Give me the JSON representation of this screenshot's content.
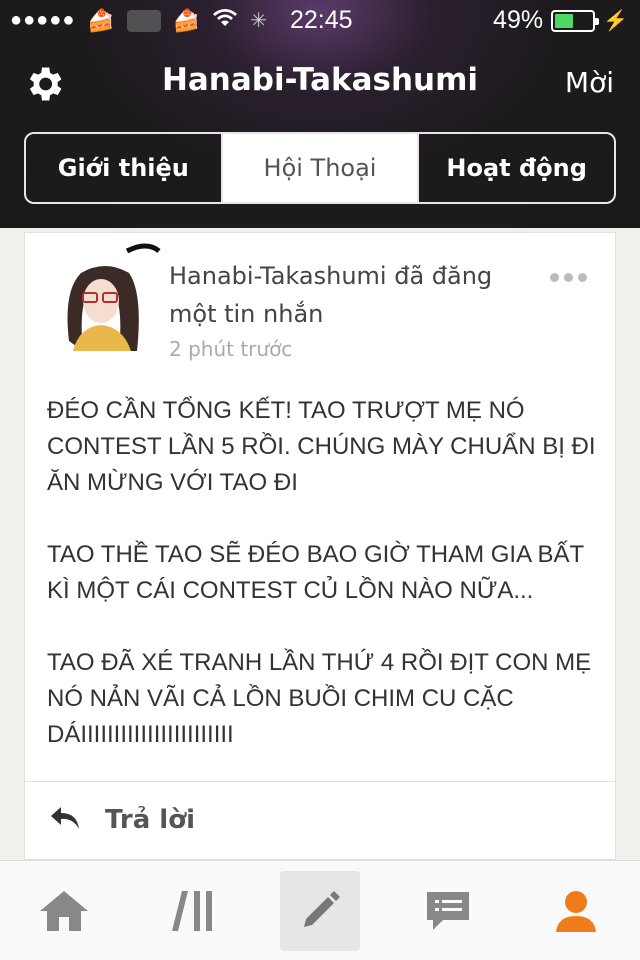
{
  "status_bar": {
    "time": "22:45",
    "battery": "49%",
    "battery_level": 0.49
  },
  "nav": {
    "title": "Hanabi-Takashumi",
    "invite": "Mời"
  },
  "tabs": [
    {
      "label": "Giới thiệu",
      "active": false
    },
    {
      "label": "Hội Thoại",
      "active": true
    },
    {
      "label": "Hoạt động",
      "active": false
    }
  ],
  "post": {
    "author_line": "Hanabi-Takashumi đã đăng một tin nhắn",
    "time_ago": "2 phút trước",
    "paragraphs": [
      "ĐÉO CẦN TỔNG KẾT! TAO TRƯỢT MẸ NÓ CONTEST LẦN 5 RỒI. CHÚNG MÀY CHUẨN BỊ ĐI ĂN MỪNG VỚI TAO ĐI",
      "TAO THỀ TAO SẼ ĐÉO BAO GIỜ THAM GIA BẤT KÌ MỘT CÁI CONTEST CỦ LỒN NÀO NỮA...",
      "TAO ĐÃ XÉ TRANH LẦN THỨ 4 RỒI ĐỊT CON MẸ NÓ NẢN VÃI CẢ LỒN BUỒI CHIM CU CẶC DÁIIIIIIIIIIIIIIIIIIIIIII"
    ],
    "reply_label": "Trả lời"
  },
  "bottom_tabs": [
    {
      "icon": "home-icon",
      "active": false
    },
    {
      "icon": "feed-icon",
      "active": false
    },
    {
      "icon": "compose-icon",
      "active": true
    },
    {
      "icon": "messages-icon",
      "active": false
    },
    {
      "icon": "profile-icon",
      "active": false
    }
  ],
  "colors": {
    "accent": "#f07b1a",
    "bar": "#1b1a1b",
    "battery_fill": "#4cd964"
  }
}
